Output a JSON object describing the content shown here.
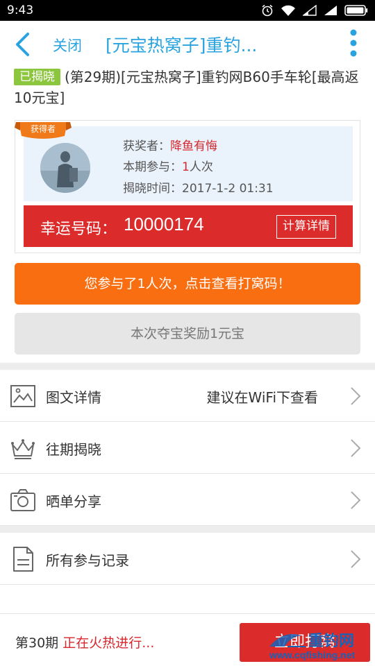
{
  "status_bar": {
    "time": "9:43"
  },
  "header": {
    "close_label": "关闭",
    "title": "[元宝热窝子]重钓..."
  },
  "product": {
    "badge": "已揭晓",
    "title": "(第29期)[元宝热窝子]重钓网B60手车轮[最高返10元宝]"
  },
  "winner": {
    "ribbon": "获得者",
    "winner_label": "获奖者：",
    "winner_name": "降鱼有悔",
    "participation_label": "本期参与：",
    "participation_count": "1",
    "participation_unit": "人次",
    "time_label": "揭晓时间：",
    "time_value": "2017-1-2 01:31",
    "lucky_label": "幸运号码：",
    "lucky_number": "10000174",
    "calc_button": "计算详情"
  },
  "actions": {
    "participated_button": "您参与了1人次，点击查看打窝码！",
    "reward_button": "本次夺宝奖励1元宝"
  },
  "menu": {
    "items": [
      {
        "label": "图文详情",
        "hint": "建议在WiFi下查看",
        "icon": "image-icon"
      },
      {
        "label": "往期揭晓",
        "hint": "",
        "icon": "crown-icon"
      },
      {
        "label": "晒单分享",
        "hint": "",
        "icon": "camera-icon"
      },
      {
        "label": "所有参与记录",
        "hint": "",
        "icon": "document-icon"
      }
    ]
  },
  "bottom": {
    "period": "第30期",
    "status": "正在火热进行...",
    "join_button": "立即打窝"
  },
  "watermark": {
    "line1": "重钓网",
    "line2": "www.cqfishing.net"
  },
  "colors": {
    "accent_blue": "#29a3e0",
    "red": "#dc2b2b",
    "orange": "#fa6e12",
    "badge_green": "#8cc63f"
  }
}
